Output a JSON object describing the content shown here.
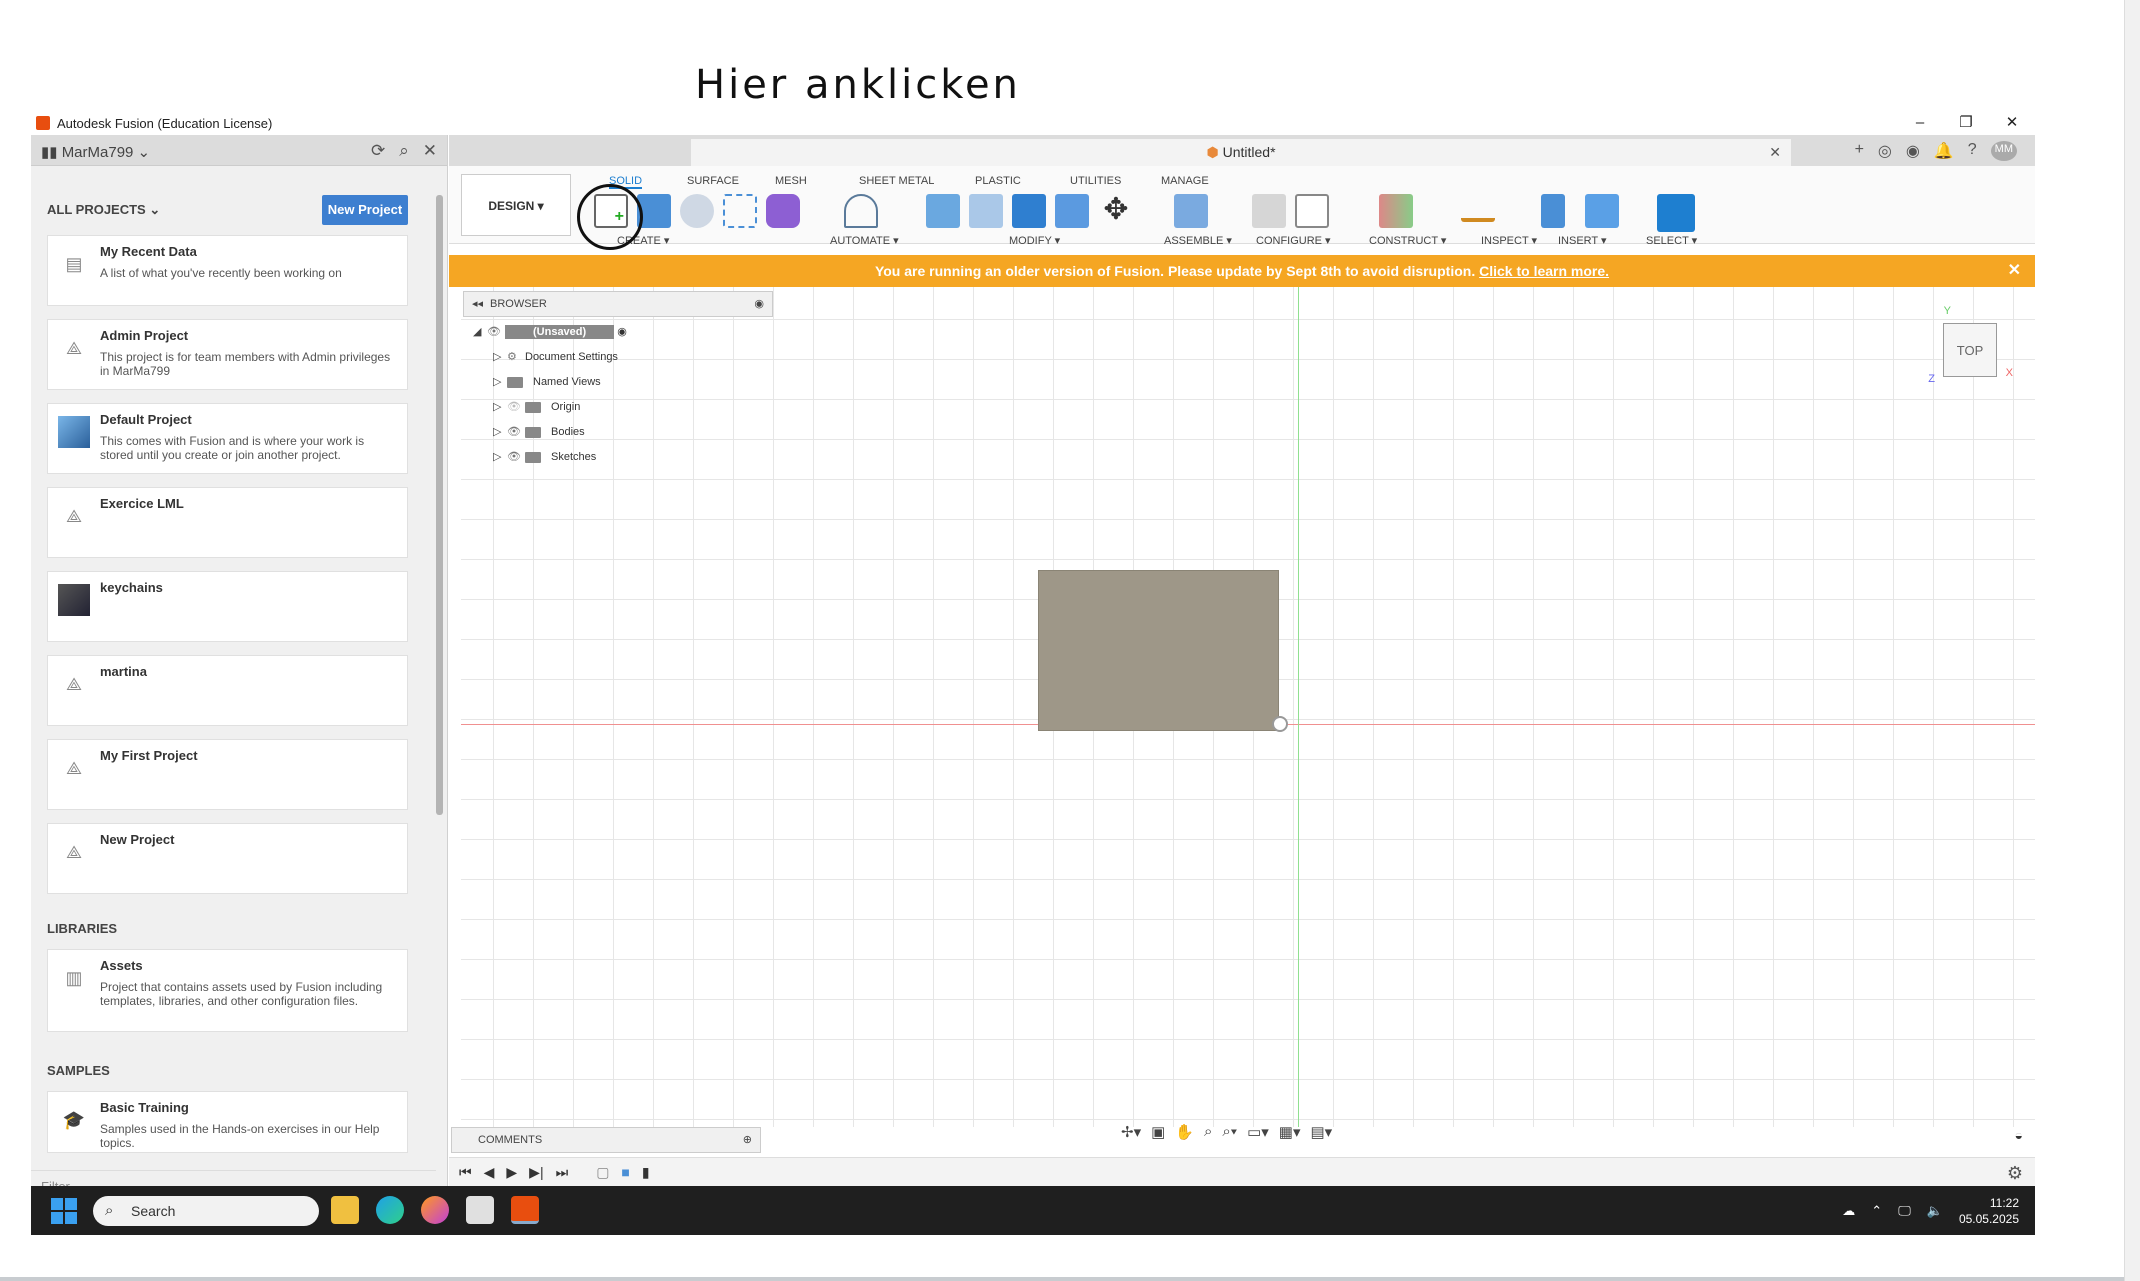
{
  "annotation": {
    "text": "Hier anklicken"
  },
  "window": {
    "title": "Autodesk Fusion (Education License)"
  },
  "left_panel": {
    "user": "MarMa799",
    "all_projects": "ALL PROJECTS",
    "new_project_button": "New Project",
    "projects": [
      {
        "title": "My Recent Data",
        "desc": "A list of what you've recently been working on"
      },
      {
        "title": "Admin Project",
        "desc": "This project is for team members with Admin privileges in MarMa799"
      },
      {
        "title": "Default Project",
        "desc": "This comes with Fusion and is where your work is stored until you create or join another project."
      },
      {
        "title": "Exercice LML",
        "desc": ""
      },
      {
        "title": "keychains",
        "desc": ""
      },
      {
        "title": "martina",
        "desc": ""
      },
      {
        "title": "My First Project",
        "desc": ""
      },
      {
        "title": "New Project",
        "desc": ""
      }
    ],
    "libraries_header": "LIBRARIES",
    "libraries": [
      {
        "title": "Assets",
        "desc": "Project that contains assets used by Fusion including templates, libraries, and other configuration files."
      }
    ],
    "samples_header": "SAMPLES",
    "samples": [
      {
        "title": "Basic Training",
        "desc": "Samples used in the Hands-on exercises in our Help topics."
      }
    ],
    "filter_placeholder": "Filter"
  },
  "document_tab": {
    "title": "Untitled*"
  },
  "ribbon": {
    "workspace": "DESIGN ▾",
    "tabs": [
      "SOLID",
      "SURFACE",
      "MESH",
      "SHEET METAL",
      "PLASTIC",
      "UTILITIES",
      "MANAGE"
    ],
    "groups": [
      "CREATE ▾",
      "AUTOMATE ▾",
      "MODIFY ▾",
      "ASSEMBLE ▾",
      "CONFIGURE ▾",
      "CONSTRUCT ▾",
      "INSPECT ▾",
      "INSERT ▾",
      "SELECT ▾"
    ]
  },
  "banner": {
    "text": "You are running an older version of Fusion. Please update by Sept 8th to avoid disruption. ",
    "link": "Click to learn more."
  },
  "browser": {
    "title": "BROWSER",
    "root": "(Unsaved)",
    "items": [
      "Document Settings",
      "Named Views",
      "Origin",
      "Bodies",
      "Sketches"
    ]
  },
  "viewcube": {
    "face": "TOP",
    "x": "X",
    "y": "Y",
    "z": "Z"
  },
  "comments": {
    "title": "COMMENTS"
  },
  "taskbar": {
    "search_placeholder": "Search",
    "time": "11:22",
    "date": "05.05.2025"
  },
  "colors": {
    "accent": "#1e7fd0",
    "banner": "#f5a623",
    "body": "#9e9788"
  }
}
